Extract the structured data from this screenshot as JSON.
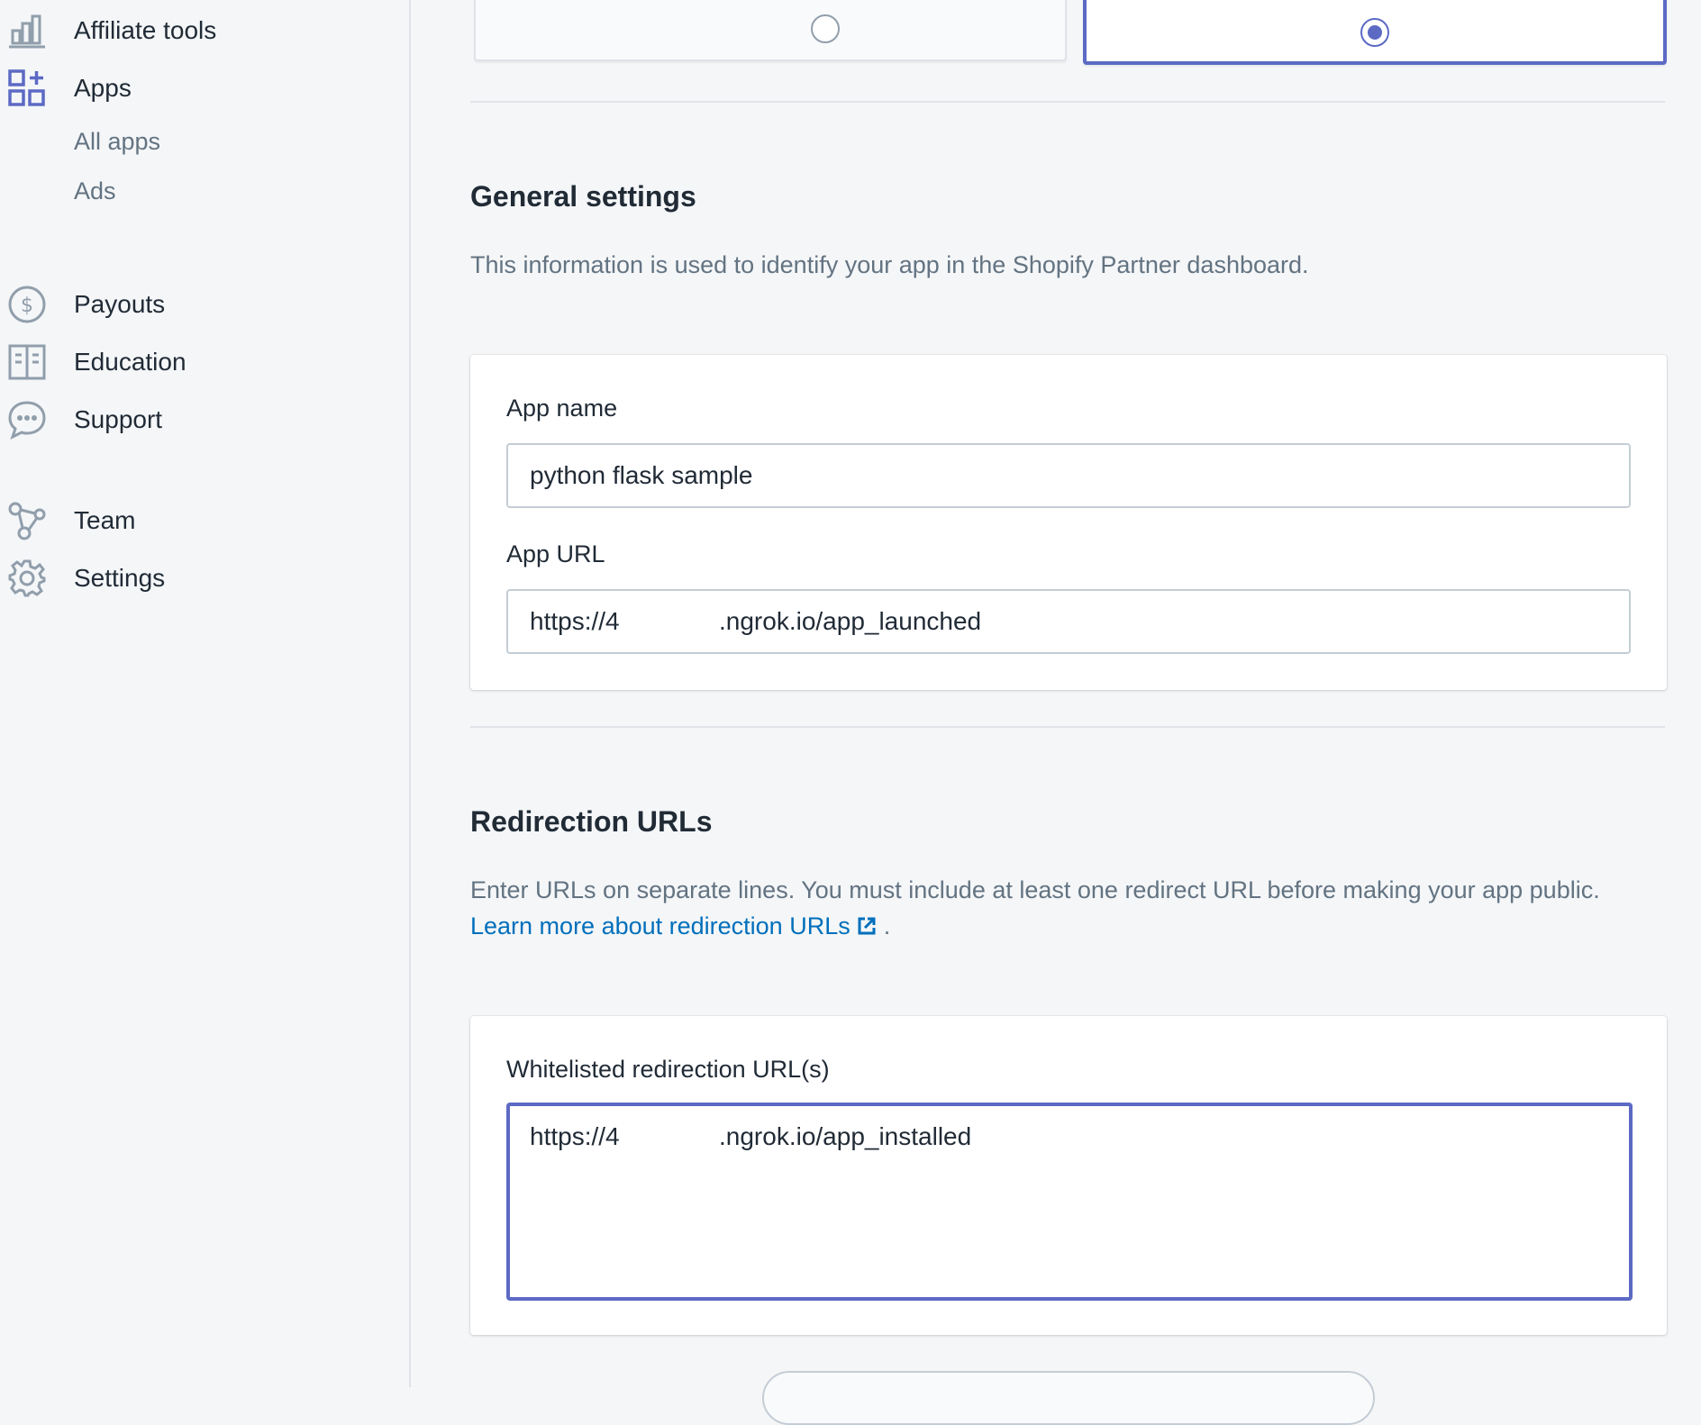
{
  "sidebar": {
    "items": [
      {
        "label": "Affiliate tools",
        "icon": "bar-chart-icon"
      },
      {
        "label": "Apps",
        "icon": "apps-icon"
      },
      {
        "label": "Payouts",
        "icon": "dollar-circle-icon"
      },
      {
        "label": "Education",
        "icon": "book-icon"
      },
      {
        "label": "Support",
        "icon": "chat-bubble-icon"
      },
      {
        "label": "Team",
        "icon": "team-icon"
      },
      {
        "label": "Settings",
        "icon": "gear-icon"
      }
    ],
    "apps_subitems": [
      {
        "label": "All apps"
      },
      {
        "label": "Ads"
      }
    ]
  },
  "main": {
    "general_settings": {
      "title": "General settings",
      "description": "This information is used to identify your app in the Shopify Partner dashboard.",
      "app_name_label": "App name",
      "app_name_value": "python flask sample",
      "app_url_label": "App URL",
      "app_url_prefix": "https://4",
      "app_url_suffix": ".ngrok.io/app_launched"
    },
    "redirection": {
      "title": "Redirection URLs",
      "description": "Enter URLs on separate lines. You must include at least one redirect URL before making your app public. ",
      "link_text": "Learn more about redirection URLs",
      "after_link": " .",
      "field_label": "Whitelisted redirection URL(s)",
      "url_prefix": "https://4",
      "url_suffix": ".ngrok.io/app_installed"
    }
  },
  "colors": {
    "accent": "#5c6ac4",
    "link": "#006fbb",
    "text": "#212b36",
    "subdued": "#637381",
    "background": "#f4f6f8"
  }
}
